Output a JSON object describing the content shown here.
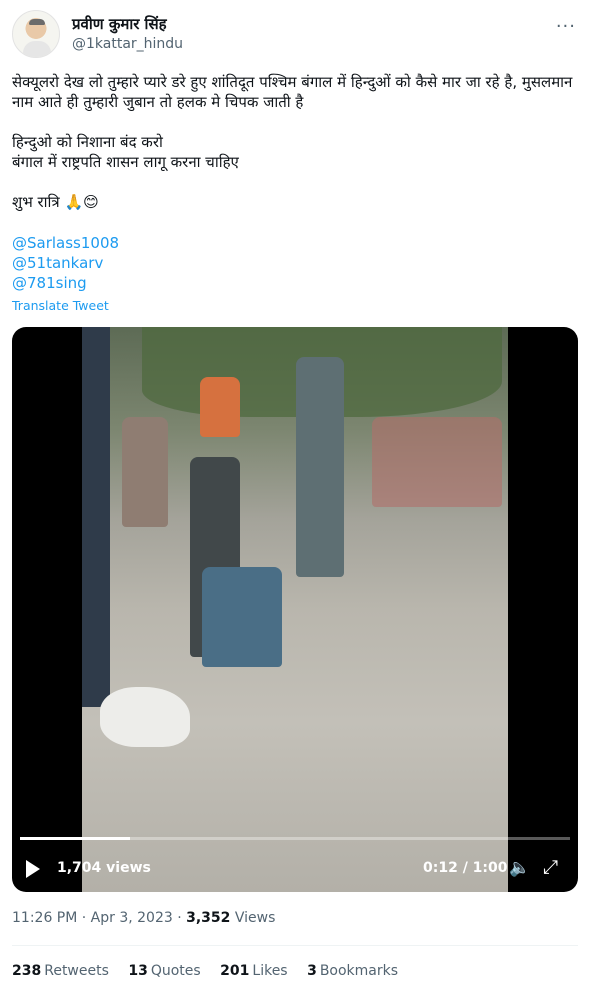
{
  "author": {
    "display_name": "प्रवीण कुमार सिंह",
    "handle": "@1kattar_hindu"
  },
  "more_label": "···",
  "tweet": {
    "text": "सेक्यूलरो देख लो तुम्हारे प्यारे डरे हुए शांतिदूत पश्चिम बंगाल में हिन्दुओं को कैसे मार जा रहे है, मुसलमान नाम आते ही तुम्हारी जुबान तो हलक मे चिपक जाती है\n\nहिन्दुओ को निशाना बंद करो\nबंगाल में राष्ट्रपति शासन लागू करना चाहिए\n\nशुभ रात्रि 🙏😊",
    "mentions": [
      "@Sarlass1008",
      "@51tankarv",
      "@781sing"
    ],
    "translate_label": "Translate Tweet"
  },
  "video": {
    "views": "1,704 views",
    "time": "0:12 / 1:00",
    "progress_fraction": 0.2,
    "play_icon": "play-icon",
    "volume_icon": "volume-icon",
    "fullscreen_icon": "fullscreen-icon"
  },
  "meta": {
    "timestamp": "11:26 PM · Apr 3, 2023 · ",
    "views_count": "3,352",
    "views_label": " Views"
  },
  "stats": [
    {
      "count": "238",
      "label": "Retweets"
    },
    {
      "count": "13",
      "label": "Quotes"
    },
    {
      "count": "201",
      "label": "Likes"
    },
    {
      "count": "3",
      "label": "Bookmarks"
    }
  ],
  "colors": {
    "accent": "#1d9bf0",
    "text": "#0f1419",
    "muted": "#536471"
  }
}
